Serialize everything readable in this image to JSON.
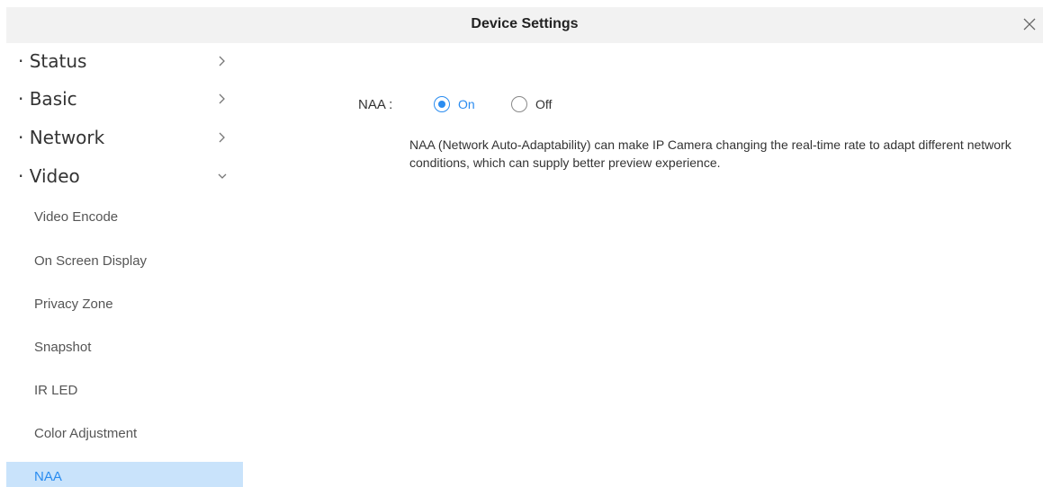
{
  "header": {
    "title": "Device Settings",
    "close_icon": "close-icon"
  },
  "sidebar": {
    "groups": [
      {
        "label": "· Status",
        "icon": "chevron-right-icon",
        "expanded": false
      },
      {
        "label": "· Basic",
        "icon": "chevron-right-icon",
        "expanded": false
      },
      {
        "label": "· Network",
        "icon": "chevron-right-icon",
        "expanded": false
      },
      {
        "label": "· Video",
        "icon": "chevron-down-icon",
        "expanded": true
      }
    ],
    "video_items": [
      {
        "label": "Video Encode"
      },
      {
        "label": "On Screen Display"
      },
      {
        "label": "Privacy Zone"
      },
      {
        "label": "Snapshot"
      },
      {
        "label": "IR LED"
      },
      {
        "label": "Color Adjustment"
      },
      {
        "label": "NAA",
        "active": true
      }
    ]
  },
  "main": {
    "naa_label": "NAA :",
    "options": [
      {
        "label": "On",
        "selected": true
      },
      {
        "label": "Off",
        "selected": false
      }
    ],
    "description": "NAA (Network Auto-Adaptability) can make IP Camera changing the real-time rate to adapt different network conditions, which can supply better preview experience."
  },
  "colors": {
    "accent": "#2a8cf0",
    "active_bg": "#c9e3fb",
    "titlebar_bg": "#f2f2f2"
  }
}
